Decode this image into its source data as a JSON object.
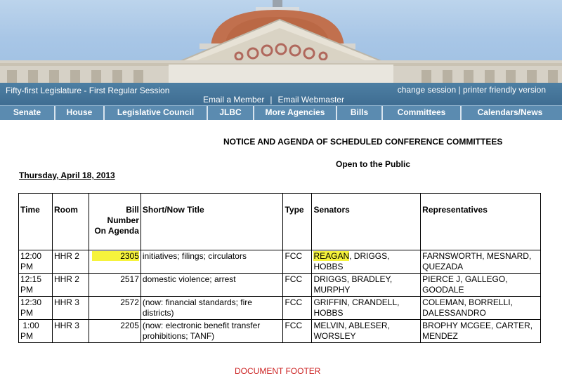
{
  "header": {
    "session": "Fifty-first Legislature - First Regular Session",
    "email_member": "Email a Member",
    "email_separator": "|",
    "email_webmaster": "Email Webmaster",
    "change_session": "change session |",
    "printer_friendly": "printer friendly version"
  },
  "nav": [
    "Senate",
    "House",
    "Legislative Council",
    "JLBC",
    "More Agencies",
    "Bills",
    "Committees",
    "Calendars/News"
  ],
  "page": {
    "title": "NOTICE AND AGENDA OF SCHEDULED CONFERENCE COMMITTEES",
    "subtitle": "Open to the Public",
    "date": "Thursday, April 18, 2013"
  },
  "table": {
    "headers": {
      "time": "Time",
      "room": "Room",
      "bill_line1": "Bill",
      "bill_line2": "Number",
      "bill_line3": "On Agenda",
      "title": "Short/Now Title",
      "type": "Type",
      "senators": "Senators",
      "representatives": "Representatives"
    },
    "rows": [
      {
        "time": "12:00 PM",
        "room": "HHR 2",
        "bill": "2305",
        "title": "initiatives; filings; circulators",
        "type": "FCC",
        "senators_first": "REAGAN",
        "senators_rest": ", DRIGGS, HOBBS",
        "representatives": "FARNSWORTH, MESNARD, QUEZADA"
      },
      {
        "time": "12:15 PM",
        "room": "HHR 2",
        "bill": "2517",
        "title": "domestic violence; arrest",
        "type": "FCC",
        "senators_first": "",
        "senators_rest": "DRIGGS, BRADLEY, MURPHY",
        "representatives": "PIERCE J, GALLEGO, GOODALE"
      },
      {
        "time": "12:30 PM",
        "room": "HHR 3",
        "bill": "2572",
        "title": "(now: financial standards; fire districts)",
        "type": "FCC",
        "senators_first": "",
        "senators_rest": "GRIFFIN, CRANDELL, HOBBS",
        "representatives": "COLEMAN, BORRELLI, DALESSANDRO"
      },
      {
        "time": " 1:00 PM",
        "room": "HHR 3",
        "bill": "2205",
        "title": "(now: electronic benefit transfer prohibitions; TANF)",
        "type": "FCC",
        "senators_first": "",
        "senators_rest": "MELVIN, ABLESER, WORSLEY",
        "representatives": "BROPHY MCGEE, CARTER, MENDEZ"
      }
    ]
  },
  "footer": "DOCUMENT FOOTER",
  "colors": {
    "highlight": "#f6f33c",
    "nav_bg": "#5b8bb0",
    "topbar_bg": "#4d7fa3"
  }
}
